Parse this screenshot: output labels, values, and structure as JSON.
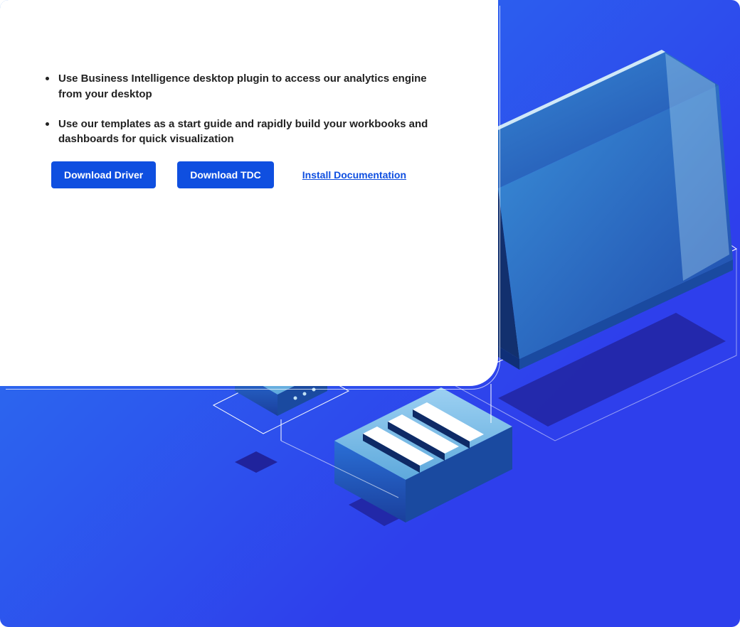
{
  "bullets": [
    "Use Business Intelligence desktop plugin to access our analytics engine from your desktop",
    "Use our templates as a start guide and rapidly build your workbooks and dashboards for quick visualization"
  ],
  "actions": {
    "download_driver": "Download Driver",
    "download_tdc": "Download TDC",
    "install_docs": "Install Documentation"
  },
  "colors": {
    "primary": "#0f4fe0",
    "bg_gradient_start": "#2a7ff0",
    "bg_gradient_end": "#2e3fec"
  }
}
